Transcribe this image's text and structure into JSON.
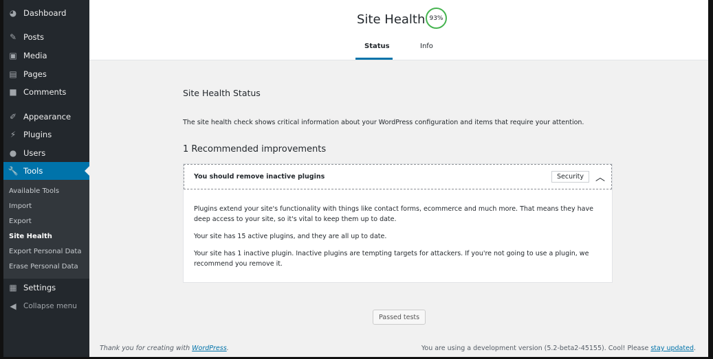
{
  "sidebar": {
    "items": [
      {
        "label": "Dashboard",
        "icon": "dashboard-icon"
      },
      {
        "label": "Posts",
        "icon": "pin-icon"
      },
      {
        "label": "Media",
        "icon": "media-icon"
      },
      {
        "label": "Pages",
        "icon": "pages-icon"
      },
      {
        "label": "Comments",
        "icon": "comment-icon"
      },
      {
        "label": "Appearance",
        "icon": "brush-icon"
      },
      {
        "label": "Plugins",
        "icon": "plug-icon"
      },
      {
        "label": "Users",
        "icon": "user-icon"
      },
      {
        "label": "Tools",
        "icon": "wrench-icon"
      },
      {
        "label": "Settings",
        "icon": "settings-icon"
      },
      {
        "label": "Collapse menu",
        "icon": "collapse-icon"
      }
    ],
    "submenu": [
      "Available Tools",
      "Import",
      "Export",
      "Site Health",
      "Export Personal Data",
      "Erase Personal Data"
    ],
    "accent": "#0073aa"
  },
  "header": {
    "title": "Site Health",
    "score": "93%",
    "tabs": [
      "Status",
      "Info"
    ]
  },
  "main": {
    "heading": "Site Health Status",
    "description": "The site health check shows critical information about your WordPress configuration and items that require your attention.",
    "improvements": "1 Recommended improvements",
    "issue": {
      "title": "You should remove inactive plugins",
      "badge": "Security",
      "paragraphs": [
        "Plugins extend your site's functionality with things like contact forms, ecommerce and much more. That means they have deep access to your site, so it's vital to keep them up to date.",
        "Your site has 15 active plugins, and they are all up to date.",
        "Your site has 1 inactive plugin. Inactive plugins are tempting targets for attackers. If you're not going to use a plugin, we recommend you remove it."
      ]
    },
    "passed_button": "Passed tests"
  },
  "footer": {
    "left_text": "Thank you for creating with ",
    "left_link": "WordPress",
    "left_end": ".",
    "right_text": "You are using a development version (5.2-beta2-45155). Cool! Please ",
    "right_link": "stay updated",
    "right_end": "."
  }
}
